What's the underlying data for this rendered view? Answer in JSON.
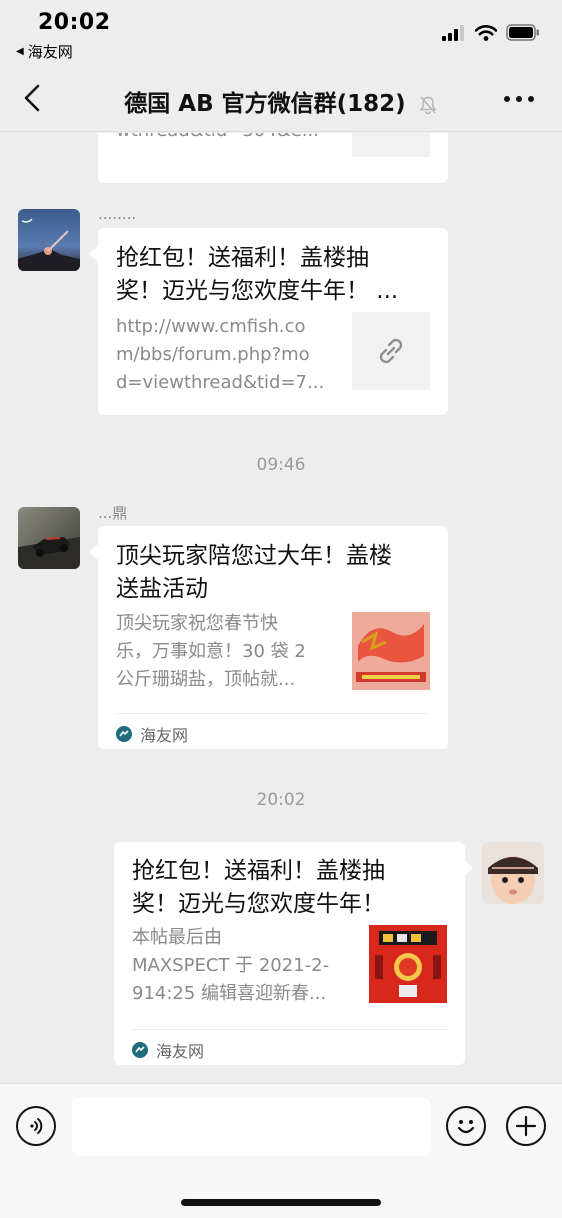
{
  "status_bar": {
    "time": "20:02",
    "back_app": "海友网",
    "back_icon": "back-triangle-icon"
  },
  "nav": {
    "title": "德国 AB  官方微信群(182)",
    "muted_icon": "bell-muted-icon",
    "back_icon": "chevron-left-icon",
    "more_icon": "more-dots-icon"
  },
  "messages": [
    {
      "type": "link-partial",
      "desc": "wthread&tid=304&e..."
    },
    {
      "type": "link",
      "sender": "........",
      "title_line1": "抢红包！送福利！盖楼抽",
      "title_line2": "奖！迈光与您欢度牛年！ ...",
      "desc_line1": "http://www.cmfish.co",
      "desc_line2": "m/bbs/forum.php?mo",
      "desc_line3": "d=viewthread&tid=7..."
    },
    {
      "type": "timestamp",
      "text": "09:46"
    },
    {
      "type": "article",
      "sender": "...鼎",
      "title_line1": "顶尖玩家陪您过大年！盖楼",
      "title_line2": "送盐活动",
      "desc_line1": "顶尖玩家祝您春节快",
      "desc_line2": "乐，万事如意！30 袋 2",
      "desc_line3": "公斤珊瑚盐，顶帖就...",
      "source": "海友网"
    },
    {
      "type": "timestamp",
      "text": "20:02"
    },
    {
      "type": "article-self",
      "title_line1": "抢红包！送福利！盖楼抽",
      "title_line2": "奖！迈光与您欢度牛年！",
      "desc_line1": "本帖最后由",
      "desc_line2": "MAXSPECT 于 2021-2-",
      "desc_line3": "914:25 编辑喜迎新春...",
      "source": "海友网"
    }
  ],
  "input": {
    "placeholder": "",
    "voice_icon": "voice-icon",
    "emoji_icon": "emoji-icon",
    "plus_icon": "plus-icon"
  },
  "colors": {
    "background": "#ededed",
    "bubble": "#ffffff",
    "meta_text": "#8a8a8a",
    "source_logo": "#1e6b7a"
  }
}
